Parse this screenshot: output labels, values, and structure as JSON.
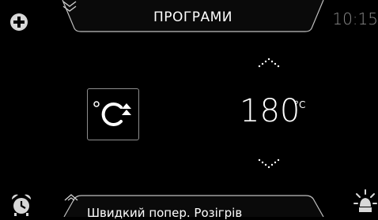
{
  "header": {
    "title": "ПРОГРАМИ",
    "clock": "10:15",
    "add_icon": "plus-circle-icon",
    "menu_icon": "double-chevron-down-icon"
  },
  "main": {
    "program_icon": "rapid-preheat-icon",
    "temperature": "180",
    "temperature_unit": "°C",
    "increase_icon": "chevron-up-icon",
    "decrease_icon": "chevron-down-icon"
  },
  "footer": {
    "function_label": "Швидкий попер. Розігрів",
    "expand_icon": "chevron-up-icon",
    "alarm_icon": "alarm-clock-icon",
    "light_icon": "lamp-icon"
  },
  "colors": {
    "background": "#000000",
    "text": "#ffffff",
    "muted": "#8a8a8a",
    "tab_border": "#bfbfbf"
  }
}
